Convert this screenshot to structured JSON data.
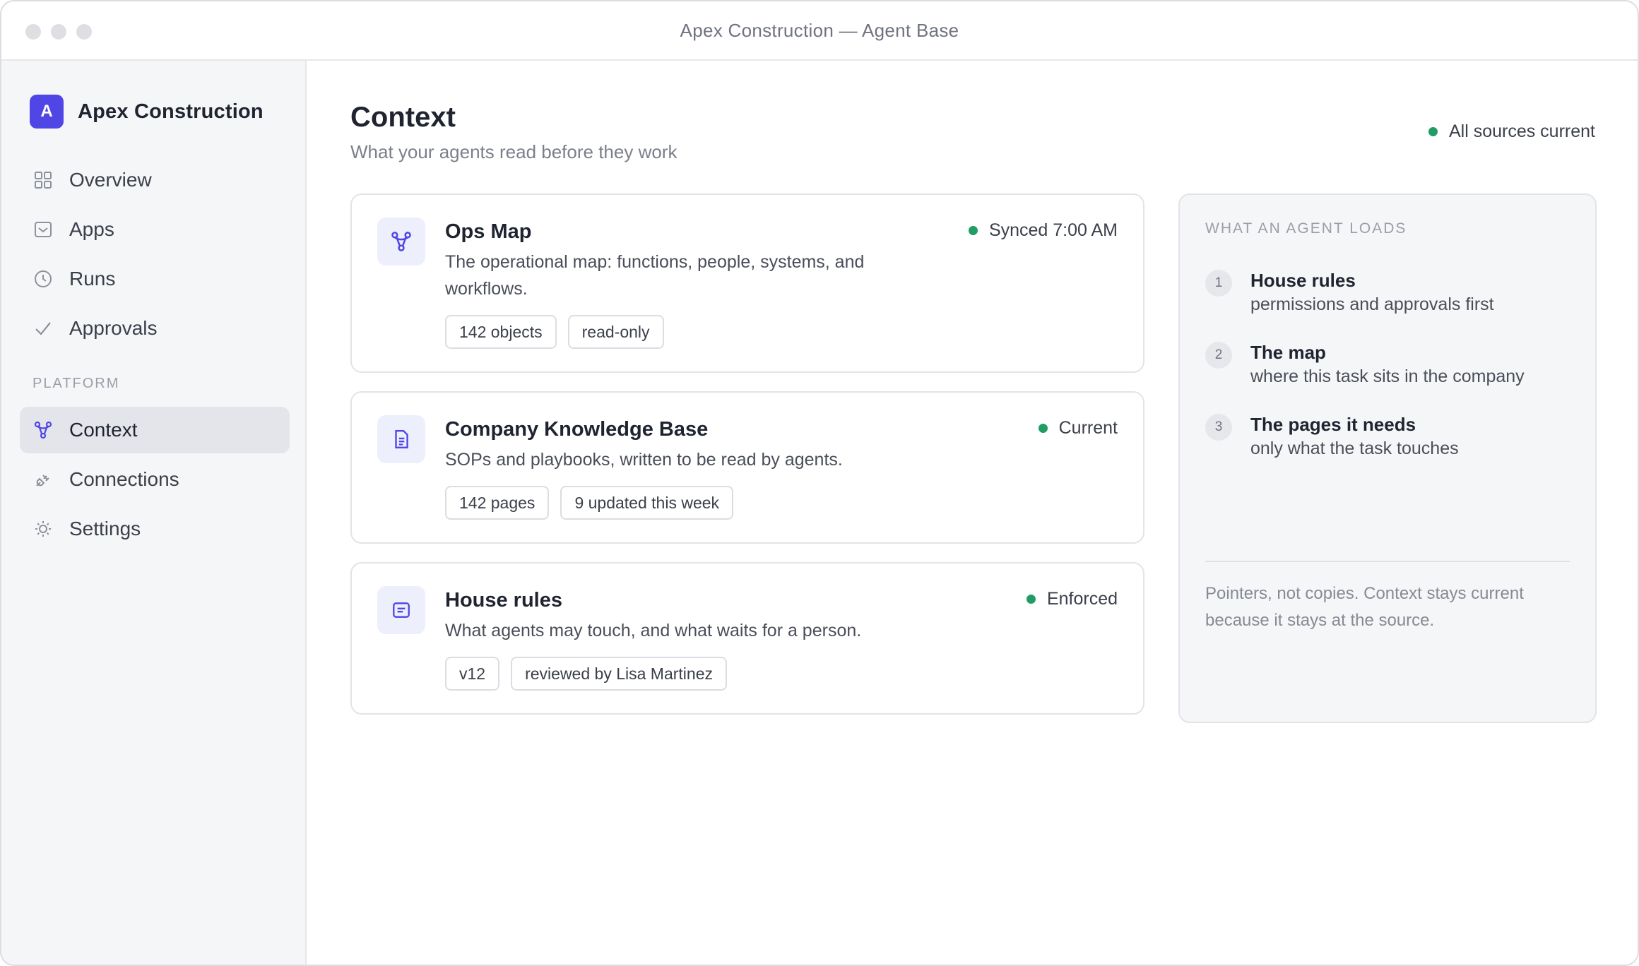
{
  "window": {
    "title": "Apex Construction — Agent Base"
  },
  "brand": {
    "initial": "A",
    "name": "Apex Construction",
    "accent": "#4f46e5"
  },
  "sidebar": {
    "items": [
      {
        "label": "Overview",
        "icon": "grid-icon"
      },
      {
        "label": "Apps",
        "icon": "inbox-icon"
      },
      {
        "label": "Runs",
        "icon": "clock-icon"
      },
      {
        "label": "Approvals",
        "icon": "check-icon"
      }
    ],
    "section_label": "PLATFORM",
    "platform_items": [
      {
        "label": "Context",
        "icon": "nodes-icon",
        "active": true
      },
      {
        "label": "Connections",
        "icon": "plug-icon"
      },
      {
        "label": "Settings",
        "icon": "gear-icon"
      }
    ]
  },
  "header": {
    "title": "Context",
    "subtitle": "What your agents read before they work",
    "status": "All sources current",
    "status_color": "#1f9d63"
  },
  "cards": [
    {
      "title": "Ops Map",
      "icon": "nodes-icon",
      "description": "The operational map: functions, people, systems, and workflows.",
      "status": "Synced 7:00 AM",
      "tags": [
        "142 objects",
        "read-only"
      ]
    },
    {
      "title": "Company Knowledge Base",
      "icon": "document-icon",
      "description": "SOPs and playbooks, written to be read by agents.",
      "status": "Current",
      "tags": [
        "142 pages",
        "9 updated this week"
      ]
    },
    {
      "title": "House rules",
      "icon": "rules-icon",
      "description": "What agents may touch, and what waits for a person.",
      "status": "Enforced",
      "tags": [
        "v12",
        "reviewed by Lisa Martinez"
      ]
    }
  ],
  "panel": {
    "heading": "WHAT AN AGENT LOADS",
    "steps": [
      {
        "number": "1",
        "title": "House rules",
        "description": "permissions and approvals first"
      },
      {
        "number": "2",
        "title": "The map",
        "description": "where this task sits in the company"
      },
      {
        "number": "3",
        "title": "The pages it needs",
        "description": "only what the task touches"
      }
    ],
    "note": "Pointers, not copies. Context stays current because it stays at the source."
  }
}
